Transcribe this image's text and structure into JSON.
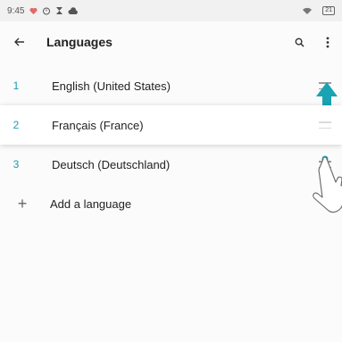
{
  "status_bar": {
    "time": "9:45",
    "battery": "21"
  },
  "app_bar": {
    "title": "Languages",
    "icons": [
      "back-arrow-icon",
      "search-icon",
      "more-vertical-icon"
    ]
  },
  "languages": [
    {
      "index": "1",
      "label": "English (United States)"
    },
    {
      "index": "2",
      "label": "Français (France)"
    },
    {
      "index": "3",
      "label": "Deutsch (Deutschland)"
    }
  ],
  "add_language": {
    "icon": "plus-icon",
    "label": "Add a language"
  },
  "colors": {
    "accent": "#16a0b0",
    "arrow": "#1aa3b3"
  }
}
